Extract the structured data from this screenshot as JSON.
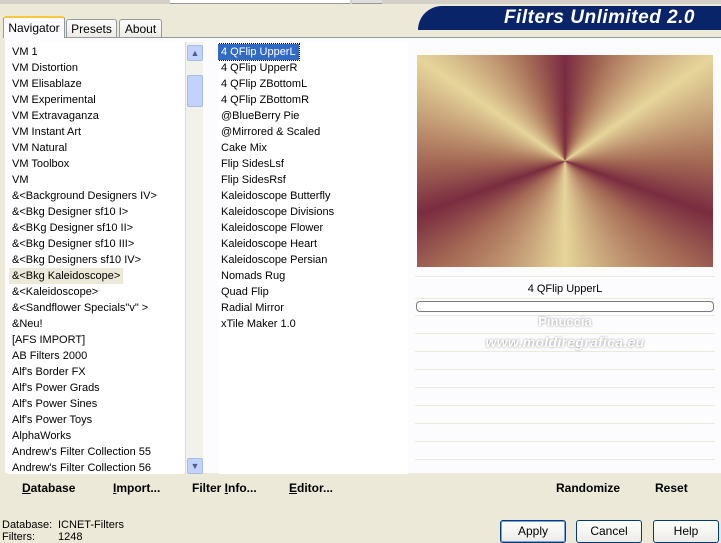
{
  "tabs": [
    {
      "label": "Navigator"
    },
    {
      "label": "Presets"
    },
    {
      "label": "About"
    }
  ],
  "title": "Filters Unlimited 2.0",
  "categories": [
    "VM 1",
    "VM Distortion",
    "VM Elisablaze",
    "VM Experimental",
    "VM Extravaganza",
    "VM Instant Art",
    "VM Natural",
    "VM Toolbox",
    "VM",
    "&<Background Designers IV>",
    "&<Bkg Designer sf10 I>",
    "&<BKg Designer sf10 II>",
    "&<Bkg Designer sf10 III>",
    "&<Bkg Designers sf10 IV>",
    "&<Bkg Kaleidoscope>",
    "&<Kaleidoscope>",
    "&<Sandflower Specials\"v\" >",
    "&Neu!",
    "[AFS IMPORT]",
    "AB Filters 2000",
    "Alf's Border FX",
    "Alf's Power Grads",
    "Alf's Power Sines",
    "Alf's Power Toys",
    "AlphaWorks",
    "Andrew's Filter Collection 55",
    "Andrew's Filter Collection 56"
  ],
  "categories_selected": "&<Bkg Kaleidoscope>",
  "filters": [
    "4 QFlip UpperL",
    "4 QFlip UpperR",
    "4 QFlip ZBottomL",
    "4 QFlip ZBottomR",
    "@BlueBerry Pie",
    "@Mirrored & Scaled",
    "Cake Mix",
    "Flip SidesLsf",
    "Flip SidesRsf",
    "Kaleidoscope Butterfly",
    "Kaleidoscope Divisions",
    "Kaleidoscope Flower",
    "Kaleidoscope Heart",
    "Kaleidoscope Persian",
    "Nomads Rug",
    "Quad Flip",
    "Radial Mirror",
    "xTile Maker 1.0"
  ],
  "filters_selected": "4 QFlip UpperL",
  "preview": {
    "filter_name": "4 QFlip UpperL",
    "watermark_line1": "Pinuccia",
    "watermark_line2": "www.moldiregrafica.eu"
  },
  "bottom_left_buttons": {
    "database": "Database",
    "import": "Import...",
    "filter_info": "Filter Info...",
    "editor": "Editor..."
  },
  "bottom_right_buttons": {
    "randomize": "Randomize",
    "reset": "Reset"
  },
  "status": {
    "database_label": "Database:",
    "database_value": "ICNET-Filters",
    "filters_label": "Filters:",
    "filters_value": "1248"
  },
  "dialog_buttons": {
    "apply": "Apply",
    "cancel": "Cancel",
    "help": "Help"
  }
}
